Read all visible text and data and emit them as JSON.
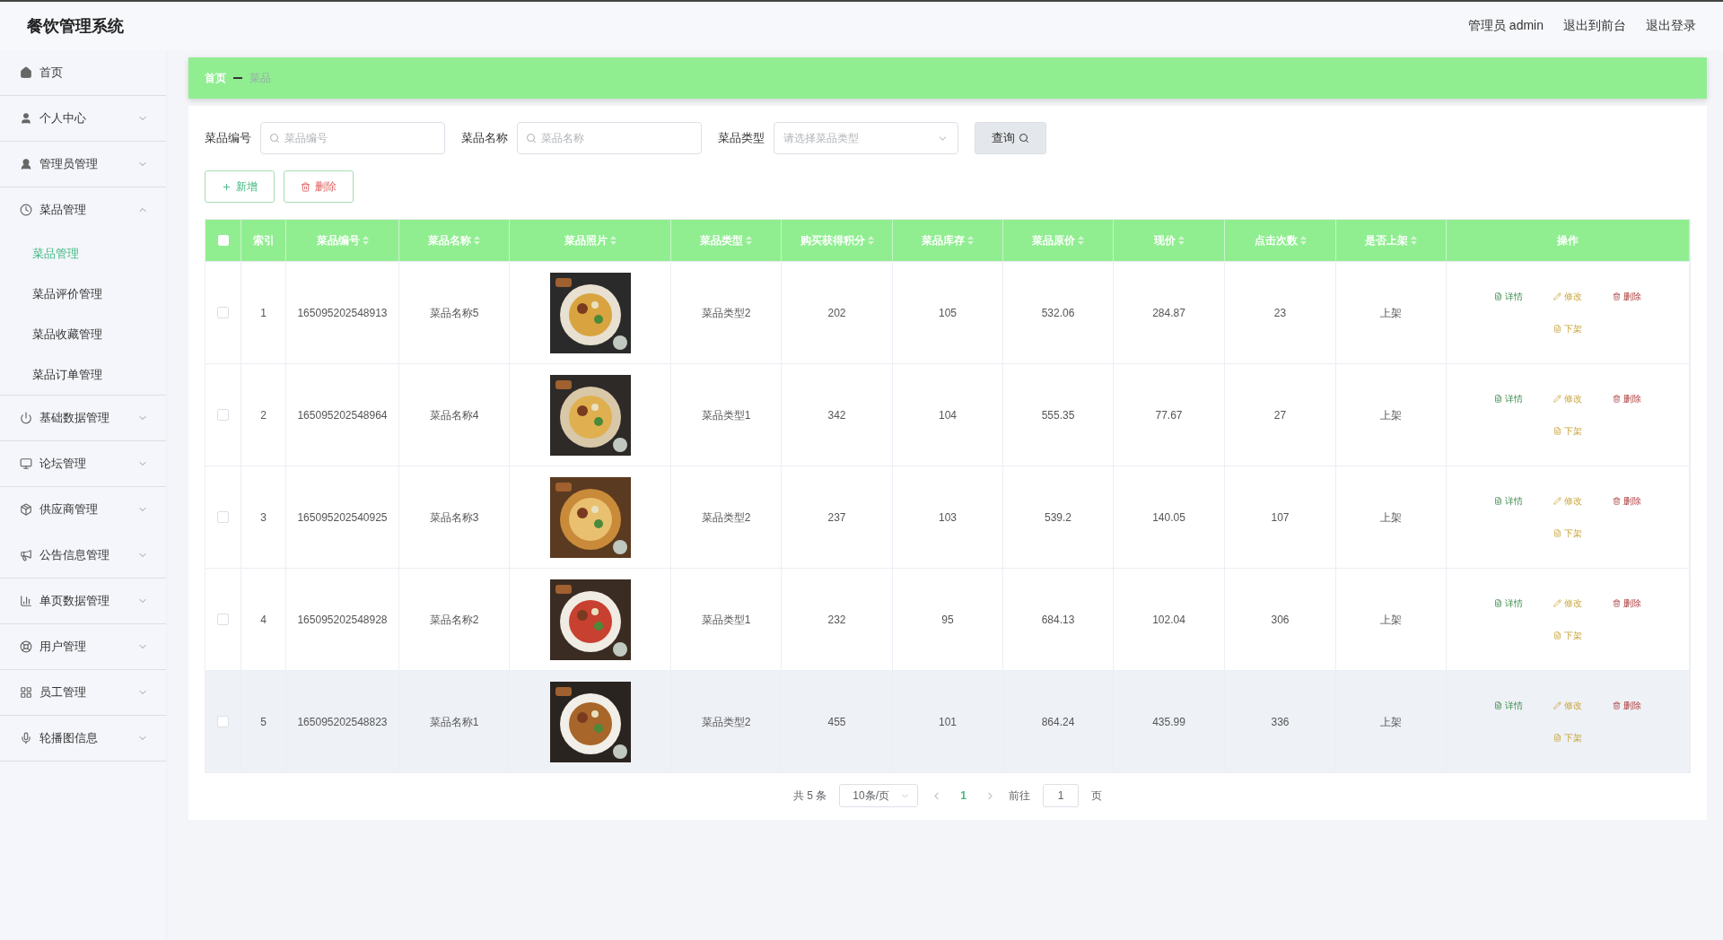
{
  "header": {
    "title": "餐饮管理系统",
    "user": "管理员 admin",
    "links": [
      "退出到前台",
      "退出登录"
    ]
  },
  "sidebar": {
    "items": [
      {
        "label": "首页",
        "expandable": false
      },
      {
        "label": "个人中心",
        "expandable": true,
        "expanded": false
      },
      {
        "label": "管理员管理",
        "expandable": true,
        "expanded": false
      },
      {
        "label": "菜品管理",
        "expandable": true,
        "expanded": true,
        "children": [
          {
            "label": "菜品管理",
            "selected": true
          },
          {
            "label": "菜品评价管理",
            "selected": false
          },
          {
            "label": "菜品收藏管理",
            "selected": false
          },
          {
            "label": "菜品订单管理",
            "selected": false
          }
        ]
      },
      {
        "label": "基础数据管理",
        "expandable": true,
        "expanded": false
      },
      {
        "label": "论坛管理",
        "expandable": true,
        "expanded": false
      },
      {
        "label": "供应商管理",
        "expandable": true,
        "expanded": false
      },
      {
        "label": "公告信息管理",
        "expandable": true,
        "expanded": false
      },
      {
        "label": "单页数据管理",
        "expandable": true,
        "expanded": false
      },
      {
        "label": "用户管理",
        "expandable": true,
        "expanded": false
      },
      {
        "label": "员工管理",
        "expandable": true,
        "expanded": false
      },
      {
        "label": "轮播图信息",
        "expandable": true,
        "expanded": false
      }
    ]
  },
  "breadcrumb": [
    "首页",
    "菜品"
  ],
  "search": {
    "fields": [
      {
        "kind": "input",
        "label": "菜品编号",
        "placeholder": "菜品编号"
      },
      {
        "kind": "input",
        "label": "菜品名称",
        "placeholder": "菜品名称"
      },
      {
        "kind": "select",
        "label": "菜品类型",
        "placeholder": "请选择菜品类型"
      }
    ],
    "button": "查询"
  },
  "actions": [
    {
      "kind": "add",
      "label": "新增"
    },
    {
      "kind": "delete",
      "label": "删除"
    }
  ],
  "table": {
    "select_all": {
      "checked": false
    },
    "columns": [
      {
        "label": "索引",
        "sortable": false
      },
      {
        "label": "菜品编号",
        "sortable": true
      },
      {
        "label": "菜品名称",
        "sortable": true
      },
      {
        "label": "菜品照片",
        "sortable": true
      },
      {
        "label": "菜品类型",
        "sortable": true
      },
      {
        "label": "购买获得积分",
        "sortable": true
      },
      {
        "label": "菜品库存",
        "sortable": true
      },
      {
        "label": "菜品原价",
        "sortable": true
      },
      {
        "label": "现价",
        "sortable": true
      },
      {
        "label": "点击次数",
        "sortable": true
      },
      {
        "label": "是否上架",
        "sortable": true
      },
      {
        "label": "操作",
        "sortable": false
      }
    ],
    "rows": [
      {
        "checked": false,
        "highlighted": false,
        "cells": [
          "1",
          "165095202548913",
          "菜品名称5",
          null,
          "菜品类型2",
          "202",
          "105",
          "532.06",
          "284.87",
          "23",
          "上架"
        ],
        "actions": [
          {
            "kind": "detail",
            "label": "详情"
          },
          {
            "kind": "edit",
            "label": "修改"
          },
          {
            "kind": "delete",
            "label": "删除"
          },
          {
            "kind": "shelf",
            "label": "下架"
          }
        ]
      },
      {
        "checked": false,
        "highlighted": false,
        "cells": [
          "2",
          "165095202548964",
          "菜品名称4",
          null,
          "菜品类型1",
          "342",
          "104",
          "555.35",
          "77.67",
          "27",
          "上架"
        ],
        "actions": [
          {
            "kind": "detail",
            "label": "详情"
          },
          {
            "kind": "edit",
            "label": "修改"
          },
          {
            "kind": "delete",
            "label": "删除"
          },
          {
            "kind": "shelf",
            "label": "下架"
          }
        ]
      },
      {
        "checked": false,
        "highlighted": false,
        "cells": [
          "3",
          "165095202540925",
          "菜品名称3",
          null,
          "菜品类型2",
          "237",
          "103",
          "539.2",
          "140.05",
          "107",
          "上架"
        ],
        "actions": [
          {
            "kind": "detail",
            "label": "详情"
          },
          {
            "kind": "edit",
            "label": "修改"
          },
          {
            "kind": "delete",
            "label": "删除"
          },
          {
            "kind": "shelf",
            "label": "下架"
          }
        ]
      },
      {
        "checked": false,
        "highlighted": false,
        "cells": [
          "4",
          "165095202548928",
          "菜品名称2",
          null,
          "菜品类型1",
          "232",
          "95",
          "684.13",
          "102.04",
          "306",
          "上架"
        ],
        "actions": [
          {
            "kind": "detail",
            "label": "详情"
          },
          {
            "kind": "edit",
            "label": "修改"
          },
          {
            "kind": "delete",
            "label": "删除"
          },
          {
            "kind": "shelf",
            "label": "下架"
          }
        ]
      },
      {
        "checked": false,
        "highlighted": true,
        "cells": [
          "5",
          "165095202548823",
          "菜品名称1",
          null,
          "菜品类型2",
          "455",
          "101",
          "864.24",
          "435.99",
          "336",
          "上架"
        ],
        "actions": [
          {
            "kind": "detail",
            "label": "详情"
          },
          {
            "kind": "edit",
            "label": "修改"
          },
          {
            "kind": "delete",
            "label": "删除"
          },
          {
            "kind": "shelf",
            "label": "下架"
          }
        ]
      }
    ]
  },
  "pagination": {
    "total": "共 5 条",
    "page_size": "10条/页",
    "pages": [
      {
        "label": "1",
        "selected": true
      }
    ],
    "goto_label": "前往",
    "goto_value": "1",
    "goto_suffix": "页"
  }
}
